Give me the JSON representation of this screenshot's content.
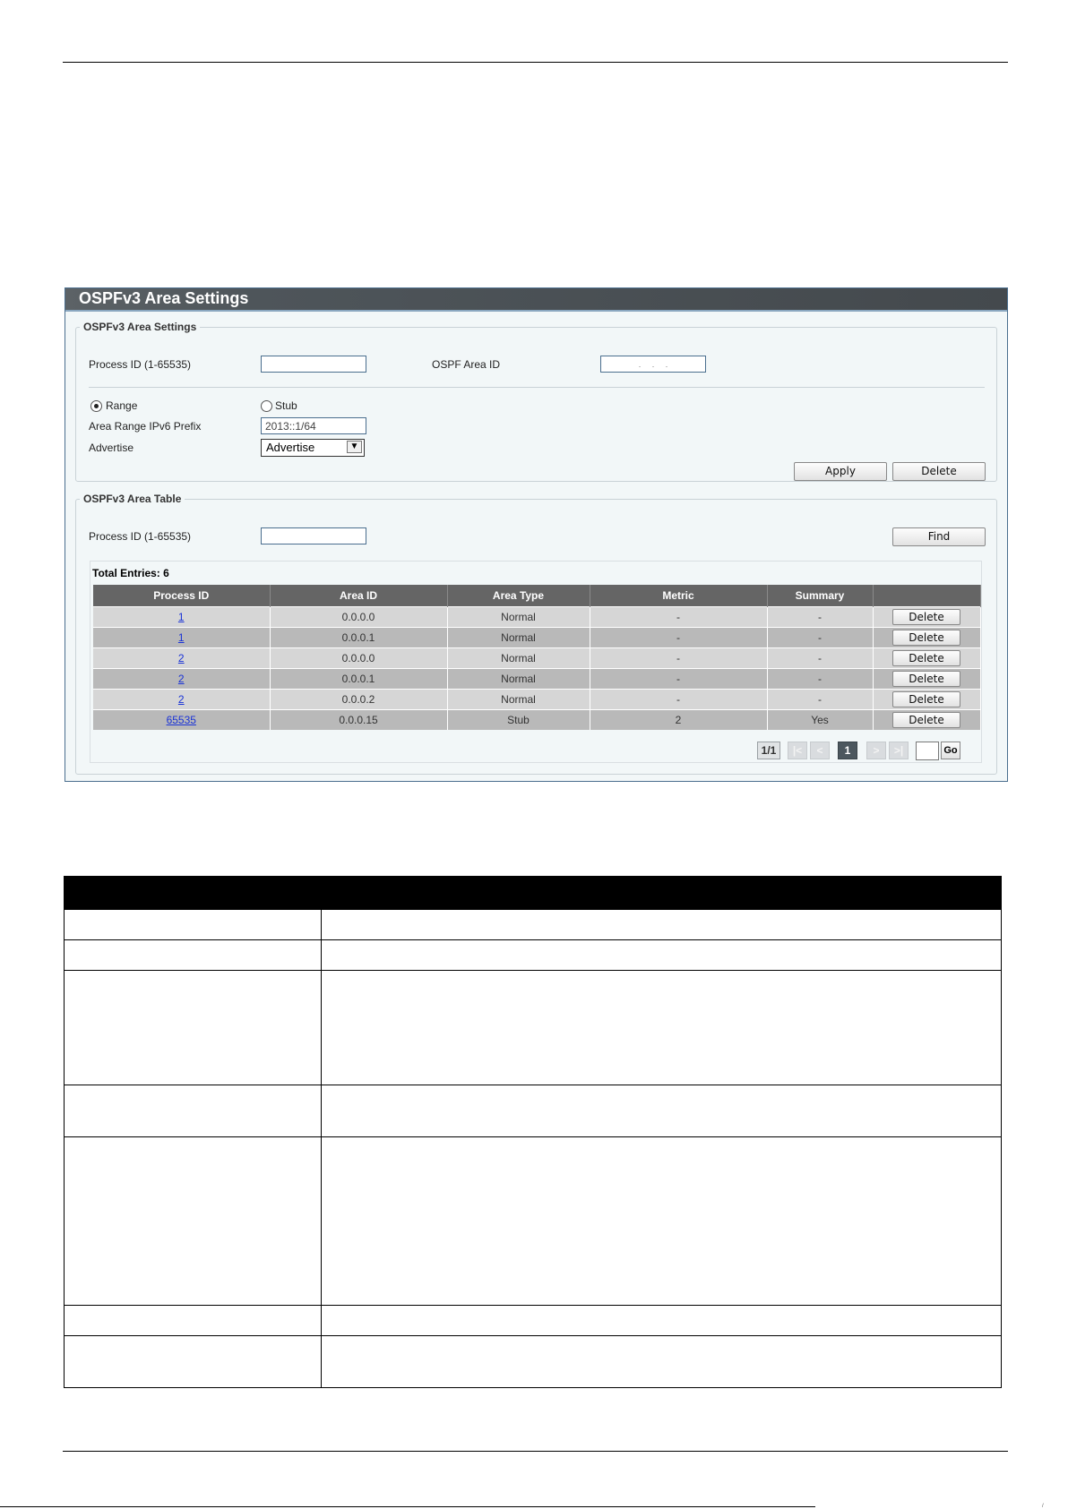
{
  "panel": {
    "title": "OSPFv3 Area Settings"
  },
  "settings": {
    "legend": "OSPFv3 Area Settings",
    "process_id_label": "Process ID (1-65535)",
    "process_id_value": "",
    "area_id_label": "OSPF Area ID",
    "area_id_value": ".     .     .",
    "range_label": "Range",
    "range_selected": true,
    "stub_label": "Stub",
    "stub_selected": false,
    "prefix_label": "Area Range IPv6 Prefix",
    "prefix_value": "2013::1/64",
    "advertise_label": "Advertise",
    "advertise_value": "Advertise",
    "apply_label": "Apply",
    "delete_label": "Delete"
  },
  "area_table": {
    "legend": "OSPFv3 Area Table",
    "process_id_label": "Process ID (1-65535)",
    "process_id_value": "",
    "find_label": "Find",
    "total_entries": "Total Entries: 6",
    "columns": [
      "Process ID",
      "Area ID",
      "Area Type",
      "Metric",
      "Summary",
      ""
    ],
    "rows": [
      {
        "process_id": "1",
        "area_id": "0.0.0.0",
        "area_type": "Normal",
        "metric": "-",
        "summary": "-",
        "action": "Delete"
      },
      {
        "process_id": "1",
        "area_id": "0.0.0.1",
        "area_type": "Normal",
        "metric": "-",
        "summary": "-",
        "action": "Delete"
      },
      {
        "process_id": "2",
        "area_id": "0.0.0.0",
        "area_type": "Normal",
        "metric": "-",
        "summary": "-",
        "action": "Delete"
      },
      {
        "process_id": "2",
        "area_id": "0.0.0.1",
        "area_type": "Normal",
        "metric": "-",
        "summary": "-",
        "action": "Delete"
      },
      {
        "process_id": "2",
        "area_id": "0.0.0.2",
        "area_type": "Normal",
        "metric": "-",
        "summary": "-",
        "action": "Delete"
      },
      {
        "process_id": "65535",
        "area_id": "0.0.0.15",
        "area_type": "Stub",
        "metric": "2",
        "summary": "Yes",
        "action": "Delete"
      }
    ],
    "pagination": {
      "page_info": "1/1",
      "first": "|<",
      "prev": "<",
      "current_page": "1",
      "next": ">",
      "last": ">|",
      "go_value": "",
      "go_label": "Go"
    }
  },
  "footer": {
    "tick": "/"
  }
}
